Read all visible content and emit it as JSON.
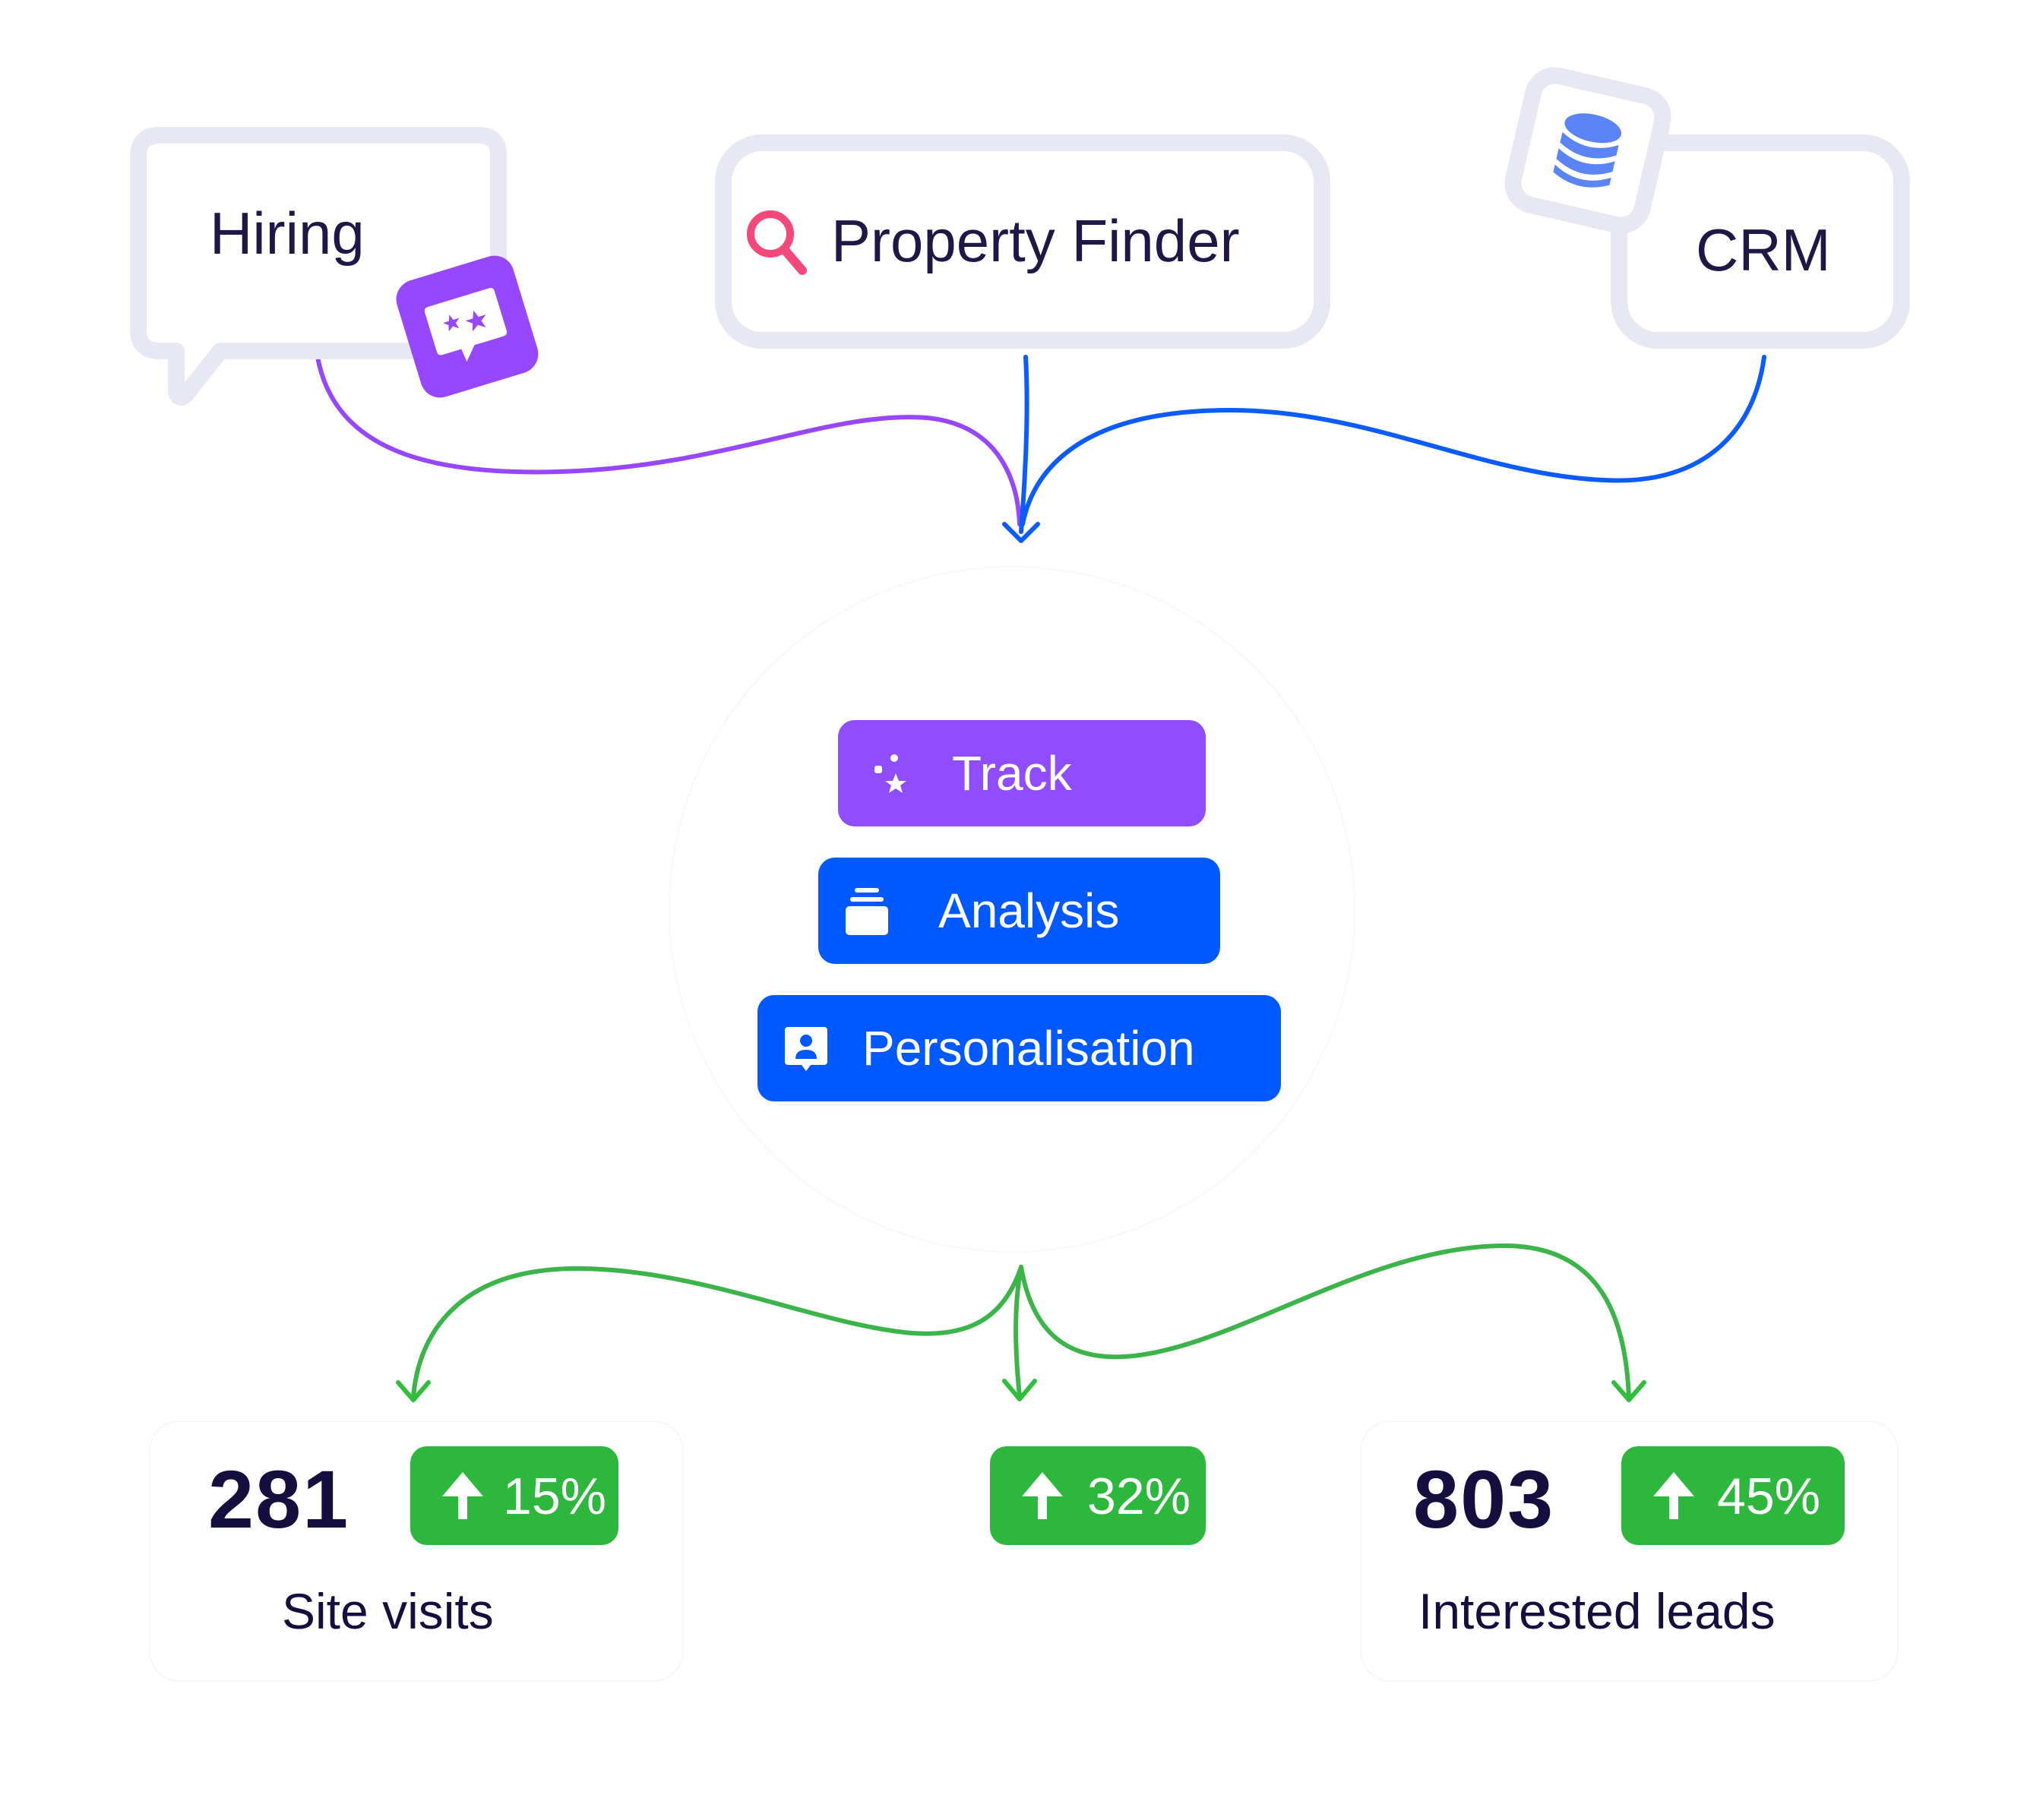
{
  "sources": {
    "hiring": {
      "label": "Hiring",
      "icon": "sparkle-chat-icon"
    },
    "property_finder": {
      "label": "Property Finder",
      "icon": "search-icon"
    },
    "crm": {
      "label": "CRM",
      "icon": "database-icon"
    }
  },
  "pipeline": [
    {
      "label": "Track",
      "icon": "sparkles-icon"
    },
    {
      "label": "Analysis",
      "icon": "stack-icon"
    },
    {
      "label": "Personalisation",
      "icon": "user-card-icon"
    }
  ],
  "outcomes": [
    {
      "value": "281",
      "change": "15%",
      "label": "Site visits"
    },
    {
      "value": "",
      "change": "32%",
      "label": ""
    },
    {
      "value": "803",
      "change": "45%",
      "label": "Interested leads"
    }
  ],
  "colors": {
    "purple": "#904cff",
    "blue": "#0059ff",
    "green": "#2db83d",
    "search_pink": "#f2487a",
    "database_blue": "#5b84f4",
    "box_border": "#e8e8f5",
    "text": "#1e1846"
  }
}
